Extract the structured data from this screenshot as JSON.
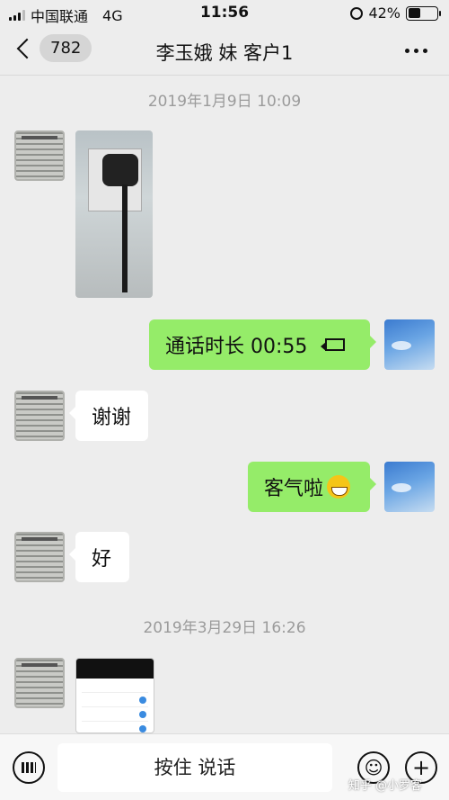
{
  "status_bar": {
    "carrier": "中国联通",
    "network": "4G",
    "time": "11:56",
    "battery": "42%",
    "battery_level": 0.42
  },
  "nav": {
    "unread_count": "782",
    "title": "李玉娥 妹 客户1"
  },
  "chat": {
    "timestamp1": "2019年1月9日 10:09",
    "call_msg": "通话时长 00:55",
    "thanks_msg": "谢谢",
    "reply_msg": "客气啦",
    "ok_msg": "好",
    "timestamp2": "2019年3月29日 16:26"
  },
  "input": {
    "hold_to_talk": "按住 说话"
  },
  "watermark": "知乎 @小罗客",
  "colors": {
    "green_bubble": "#95ec69",
    "background": "#ededed"
  }
}
